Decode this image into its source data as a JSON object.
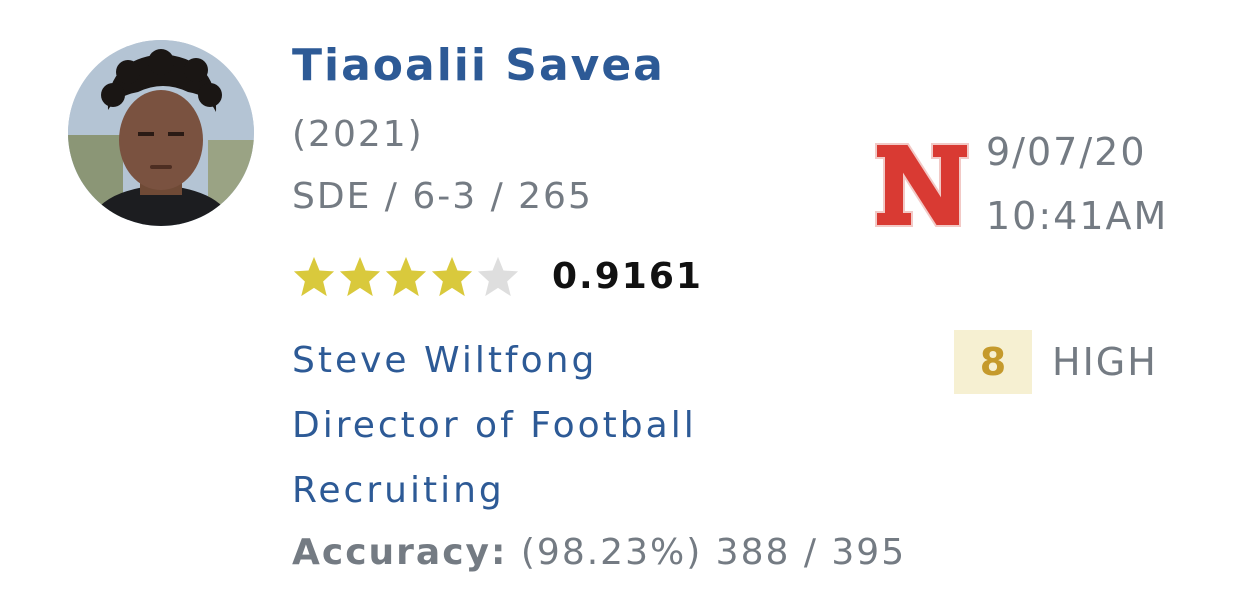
{
  "prediction": {
    "player": {
      "name": "Tiaoalii Savea",
      "class_year": "(2021)",
      "position_size": "SDE / 6-3 / 265",
      "rating": "0.9161",
      "stars": 4,
      "max_stars": 5,
      "avatar": "player-photo"
    },
    "school": {
      "logo_icon": "nebraska-n-logo",
      "logo_color": "#d93a33"
    },
    "timestamp": {
      "date": "9/07/20",
      "time": "10:41AM"
    },
    "analyst": {
      "name": "Steve Wiltfong",
      "title_line1": "Director of Football",
      "title_line2": "Recruiting"
    },
    "accuracy": {
      "label": "Accuracy:",
      "value": "(98.23%) 388 / 395"
    },
    "confidence": {
      "score": "8",
      "level": "HIGH"
    },
    "colors": {
      "link": "#2d5a96",
      "muted": "#747b83",
      "star_filled": "#d9c93c",
      "star_empty": "#dedede",
      "badge_bg": "#f6f0d2",
      "badge_text": "#c59a2c"
    }
  }
}
